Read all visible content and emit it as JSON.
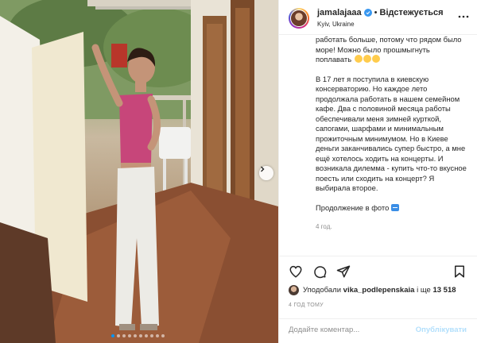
{
  "post": {
    "username": "jamalajaaa",
    "follow_status": "Відстежується",
    "separator": "•",
    "location": "Kyiv, Ukraine",
    "caption_paragraphs": [
      "работать больше, потому что рядом было море! Можно было прошмыгнуть поплавать",
      "В 17 лет я поступила в киевскую консерваторию. Но каждое лето продолжала работать в нашем семейном кафе. Два с половиной месяца работы обеспечивали меня зимней курткой, сапогами, шарфами и минимальным прожиточным минимумом. Но в Киеве деньги заканчивались супер быстро, а мне ещё хотелось ходить на концерты. И возникала дилемма - купить что-то вкусное поесть или сходить на концерт? Я выбирала второе.",
      "Продолжение в фото"
    ],
    "caption_time": "4 год."
  },
  "likes": {
    "prefix": "Уподобали",
    "user": "vika_podlepenskaia",
    "suffix": "і ще",
    "count": "13 518"
  },
  "posted_ago": "4 ГОД ТОМУ",
  "comment": {
    "placeholder": "Додайте коментар...",
    "publish_label": "Опублікувати"
  },
  "icons": {
    "like": "heart-icon",
    "comment": "comment-icon",
    "share": "paper-plane-icon",
    "save": "bookmark-icon",
    "more": "more-options-icon",
    "verified": "verified-badge-icon",
    "next": "chevron-right-icon"
  },
  "carousel": {
    "total": 10,
    "active_index": 0
  },
  "colors": {
    "accent": "#0095f6",
    "verified": "#3897f0",
    "publish_disabled": "#b2dffc"
  }
}
